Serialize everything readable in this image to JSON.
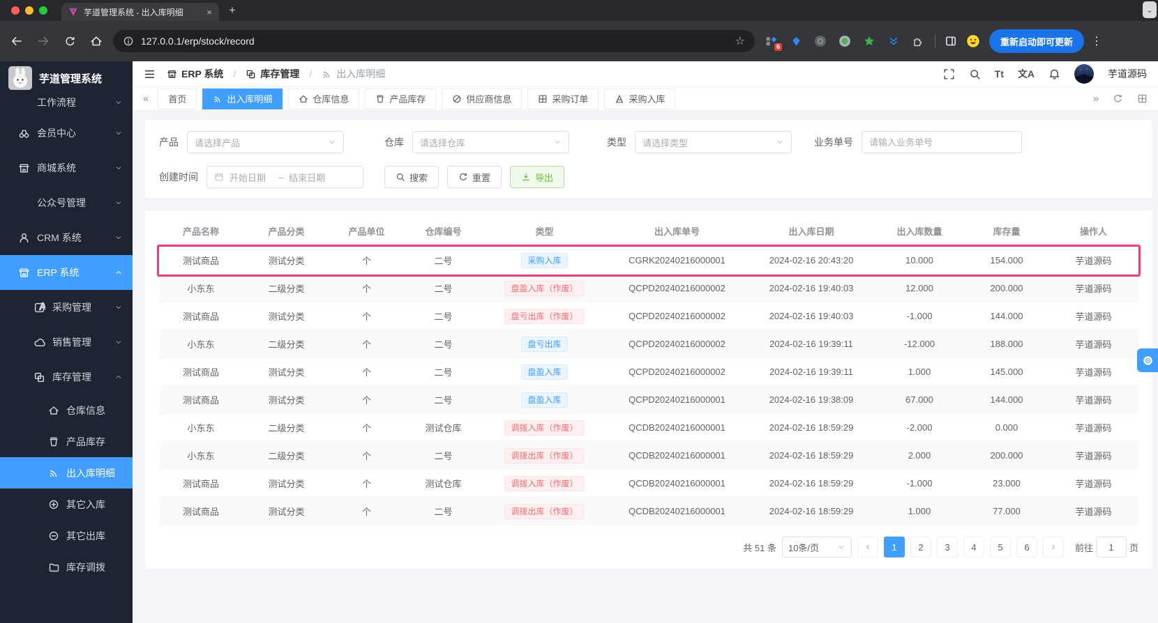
{
  "colors": {
    "accent": "#409eff",
    "highlight_box": "#ec3c78",
    "badge_blue": "#409eff",
    "badge_red": "#f56c6c",
    "update_button": "#1a73e8"
  },
  "glyphs": {
    "collapse_left": "«",
    "expand_right": "»",
    "more_vert": "⋮",
    "bookmark_star": "☆",
    "new_tab": "+",
    "close_tab": "×",
    "font_size": "Tt",
    "language": "文A",
    "scroll_chevron": "⌄"
  },
  "browser": {
    "tab_title": "芋道管理系统 - 出入库明细",
    "url": "127.0.0.1/erp/stock/record",
    "update_button_label": "重新启动即可更新",
    "extension_badge_count": "6"
  },
  "sidebar": {
    "app_title": "芋道管理系统",
    "items": [
      {
        "label": "工作流程"
      },
      {
        "label": "会员中心"
      },
      {
        "label": "商城系统"
      },
      {
        "label": "公众号管理"
      },
      {
        "label": "CRM 系统"
      },
      {
        "label": "ERP 系统"
      },
      {
        "label": "采购管理"
      },
      {
        "label": "销售管理"
      },
      {
        "label": "库存管理"
      },
      {
        "label": "仓库信息"
      },
      {
        "label": "产品库存"
      },
      {
        "label": "出入库明细"
      },
      {
        "label": "其它入库"
      },
      {
        "label": "其它出库"
      },
      {
        "label": "库存调拨"
      }
    ]
  },
  "header": {
    "breadcrumb": [
      {
        "label": "ERP 系统"
      },
      {
        "label": "库存管理"
      },
      {
        "label": "出入库明细"
      }
    ],
    "username": "芋道源码"
  },
  "tabbar": {
    "items": [
      {
        "label": "首页"
      },
      {
        "label": "出入库明细"
      },
      {
        "label": "仓库信息"
      },
      {
        "label": "产品库存"
      },
      {
        "label": "供应商信息"
      },
      {
        "label": "采购订单"
      },
      {
        "label": "采购入库"
      }
    ]
  },
  "filters": {
    "product_label": "产品",
    "product_placeholder": "请选择产品",
    "warehouse_label": "仓库",
    "warehouse_placeholder": "请选择仓库",
    "type_label": "类型",
    "type_placeholder": "请选择类型",
    "bizno_label": "业务单号",
    "bizno_placeholder": "请输入业务单号",
    "created_label": "创建时间",
    "date_start_placeholder": "开始日期",
    "date_separator": "–",
    "date_end_placeholder": "结束日期",
    "search_label": "搜索",
    "reset_label": "重置",
    "export_label": "导出"
  },
  "table": {
    "columns": [
      "产品名称",
      "产品分类",
      "产品单位",
      "仓库编号",
      "类型",
      "出入库单号",
      "出入库日期",
      "出入库数量",
      "库存量",
      "操作人"
    ],
    "rows": [
      {
        "product": "测试商品",
        "category": "测试分类",
        "unit": "个",
        "warehouse": "二号",
        "type": "采购入库",
        "type_style": "blue",
        "order_no": "CGRK20240216000001",
        "datetime": "2024-02-16 20:43:20",
        "quantity": "10.000",
        "stock": "154.000",
        "operator": "芋道源码",
        "row_cls": "highlighted"
      },
      {
        "product": "小东东",
        "category": "二级分类",
        "unit": "个",
        "warehouse": "二号",
        "type": "盘盈入库（作废）",
        "type_style": "red",
        "order_no": "QCPD20240216000002",
        "datetime": "2024-02-16 19:40:03",
        "quantity": "12.000",
        "stock": "200.000",
        "operator": "芋道源码",
        "row_cls": ""
      },
      {
        "product": "测试商品",
        "category": "测试分类",
        "unit": "个",
        "warehouse": "二号",
        "type": "盘亏出库（作废）",
        "type_style": "red",
        "order_no": "QCPD20240216000002",
        "datetime": "2024-02-16 19:40:03",
        "quantity": "-1.000",
        "stock": "144.000",
        "operator": "芋道源码",
        "row_cls": ""
      },
      {
        "product": "小东东",
        "category": "二级分类",
        "unit": "个",
        "warehouse": "二号",
        "type": "盘亏出库",
        "type_style": "blue",
        "order_no": "QCPD20240216000002",
        "datetime": "2024-02-16 19:39:11",
        "quantity": "-12.000",
        "stock": "188.000",
        "operator": "芋道源码",
        "row_cls": ""
      },
      {
        "product": "测试商品",
        "category": "测试分类",
        "unit": "个",
        "warehouse": "二号",
        "type": "盘盈入库",
        "type_style": "blue",
        "order_no": "QCPD20240216000002",
        "datetime": "2024-02-16 19:39:11",
        "quantity": "1.000",
        "stock": "145.000",
        "operator": "芋道源码",
        "row_cls": ""
      },
      {
        "product": "测试商品",
        "category": "测试分类",
        "unit": "个",
        "warehouse": "二号",
        "type": "盘盈入库",
        "type_style": "blue",
        "order_no": "QCPD20240216000001",
        "datetime": "2024-02-16 19:38:09",
        "quantity": "67.000",
        "stock": "144.000",
        "operator": "芋道源码",
        "row_cls": ""
      },
      {
        "product": "小东东",
        "category": "二级分类",
        "unit": "个",
        "warehouse": "测试仓库",
        "type": "调拨入库（作废）",
        "type_style": "red",
        "order_no": "QCDB20240216000001",
        "datetime": "2024-02-16 18:59:29",
        "quantity": "-2.000",
        "stock": "0.000",
        "operator": "芋道源码",
        "row_cls": ""
      },
      {
        "product": "小东东",
        "category": "二级分类",
        "unit": "个",
        "warehouse": "二号",
        "type": "调拨出库（作废）",
        "type_style": "red",
        "order_no": "QCDB20240216000001",
        "datetime": "2024-02-16 18:59:29",
        "quantity": "2.000",
        "stock": "200.000",
        "operator": "芋道源码",
        "row_cls": ""
      },
      {
        "product": "测试商品",
        "category": "测试分类",
        "unit": "个",
        "warehouse": "测试仓库",
        "type": "调拨入库（作废）",
        "type_style": "red",
        "order_no": "QCDB20240216000001",
        "datetime": "2024-02-16 18:59:29",
        "quantity": "-1.000",
        "stock": "23.000",
        "operator": "芋道源码",
        "row_cls": ""
      },
      {
        "product": "测试商品",
        "category": "测试分类",
        "unit": "个",
        "warehouse": "二号",
        "type": "调拨出库（作废）",
        "type_style": "red",
        "order_no": "QCDB20240216000001",
        "datetime": "2024-02-16 18:59:29",
        "quantity": "1.000",
        "stock": "77.000",
        "operator": "芋道源码",
        "row_cls": ""
      }
    ]
  },
  "pagination": {
    "total_label": "共 51 条",
    "page_size": "10条/页",
    "pages": [
      "1",
      "2",
      "3",
      "4",
      "5",
      "6"
    ],
    "goto_label": "前往",
    "goto_value": "1",
    "page_suffix": "页"
  }
}
